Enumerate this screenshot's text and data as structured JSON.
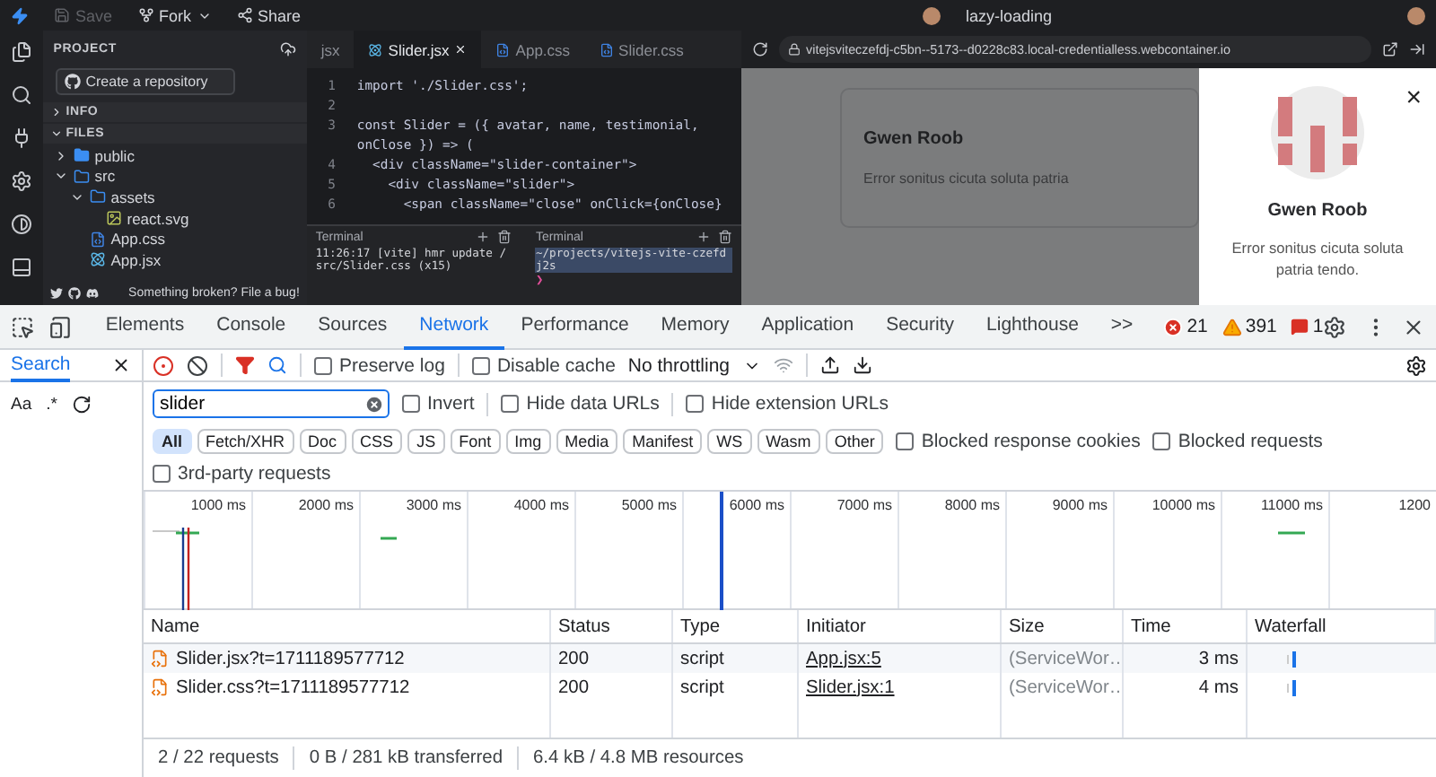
{
  "topbar": {
    "save": {
      "label": "Save",
      "disabled": true
    },
    "fork": "Fork",
    "share": "Share",
    "project": "lazy-loading"
  },
  "sidebar": {
    "title": "PROJECT",
    "repo_button": "Create a repository",
    "sections": [
      {
        "label": "INFO",
        "expanded": false
      },
      {
        "label": "FILES",
        "expanded": true
      }
    ],
    "tree": [
      {
        "name": "public",
        "kind": "folder",
        "expanded": false
      },
      {
        "name": "src",
        "kind": "folder",
        "expanded": true,
        "children": [
          {
            "name": "assets",
            "kind": "folder",
            "expanded": true,
            "children": [
              {
                "name": "react.svg",
                "kind": "image"
              }
            ]
          },
          {
            "name": "App.css",
            "kind": "css"
          },
          {
            "name": "App.jsx",
            "kind": "jsx"
          }
        ]
      }
    ],
    "footer": "Something broken? File a bug!"
  },
  "editor": {
    "tabs": [
      {
        "label": "jsx",
        "selected": false
      },
      {
        "label": "Slider.jsx",
        "selected": true
      },
      {
        "label": "App.css",
        "selected": false
      },
      {
        "label": "Slider.css",
        "selected": false
      }
    ],
    "lines": [
      {
        "number": "1",
        "text": "import './Slider.css';"
      },
      {
        "number": "2"
      },
      {
        "number": "3",
        "text": "const Slider = ({ avatar, name, testimonial,"
      },
      {
        "text": "onClose }) => ("
      },
      {
        "number": "4",
        "text": "  <div className=\"slider-container\">"
      },
      {
        "number": "5",
        "text": "    <div className=\"slider\">"
      },
      {
        "number": "6",
        "text": "      <span className=\"close\" onClick={onClose}"
      }
    ],
    "terminals": [
      {
        "title": "Terminal",
        "output": "11:26:17 [vite] hmr update /src/Slider.css (x15)"
      },
      {
        "title": "Terminal",
        "output": "~/projects/vitejs-vite-czefdj2s",
        "prompt": "❯"
      }
    ]
  },
  "preview": {
    "url": "vitejsviteczefdj-c5bn--5173--d0228c83.local-credentialless.webcontainer.io",
    "card": {
      "name": "Gwen Roob",
      "text": "Error sonitus cicuta soluta patria"
    },
    "modal": {
      "name": "Gwen Roob",
      "text": "Error sonitus cicuta soluta patria tendo.",
      "close": "×"
    }
  },
  "devtools": {
    "tabs": [
      {
        "label": "Elements",
        "selected": false
      },
      {
        "label": "Console",
        "selected": false
      },
      {
        "label": "Sources",
        "selected": false
      },
      {
        "label": "Network",
        "selected": true
      },
      {
        "label": "Performance",
        "selected": false
      },
      {
        "label": "Memory",
        "selected": false
      },
      {
        "label": "Application",
        "selected": false
      },
      {
        "label": "Security",
        "selected": false
      },
      {
        "label": "Lighthouse",
        "selected": false
      }
    ],
    "more": ">>",
    "errors": "21",
    "warnings": "391",
    "issues": "1",
    "search_pane": {
      "tab": "Search",
      "match_case": "Aa",
      "regex": ".*"
    },
    "toolbar": {
      "preserve_log": {
        "label": "Preserve log",
        "checked": false
      },
      "disable_cache": {
        "label": "Disable cache",
        "checked": false
      },
      "throttling": "No throttling"
    },
    "filter": {
      "value": "slider",
      "options": [
        {
          "label": "Invert",
          "checked": false
        },
        {
          "label": "Hide data URLs",
          "checked": false
        },
        {
          "label": "Hide extension URLs",
          "checked": false
        }
      ]
    },
    "types": [
      {
        "label": "All",
        "selected": true
      },
      {
        "label": "Fetch/XHR",
        "selected": false
      },
      {
        "label": "Doc",
        "selected": false
      },
      {
        "label": "CSS",
        "selected": false
      },
      {
        "label": "JS",
        "selected": false
      },
      {
        "label": "Font",
        "selected": false
      },
      {
        "label": "Img",
        "selected": false
      },
      {
        "label": "Media",
        "selected": false
      },
      {
        "label": "Manifest",
        "selected": false
      },
      {
        "label": "WS",
        "selected": false
      },
      {
        "label": "Wasm",
        "selected": false
      },
      {
        "label": "Other",
        "selected": false
      }
    ],
    "type_options": [
      {
        "label": "Blocked response cookies",
        "checked": false
      },
      {
        "label": "Blocked requests",
        "checked": false
      }
    ],
    "third_party": {
      "label": "3rd-party requests",
      "checked": false
    },
    "overview_ticks": [
      "1000 ms",
      "2000 ms",
      "3000 ms",
      "4000 ms",
      "5000 ms",
      "6000 ms",
      "7000 ms",
      "8000 ms",
      "9000 ms",
      "10000 ms",
      "11000 ms",
      "1200"
    ],
    "table": {
      "columns": [
        "Name",
        "Status",
        "Type",
        "Initiator",
        "Size",
        "Time",
        "Waterfall"
      ],
      "rows": [
        {
          "name": "Slider.jsx?t=1711189577712",
          "status": "200",
          "type": "script",
          "initiator": "App.jsx:5",
          "size": "(ServiceWor…",
          "time": "3 ms"
        },
        {
          "name": "Slider.css?t=1711189577712",
          "status": "200",
          "type": "script",
          "initiator": "Slider.jsx:1",
          "size": "(ServiceWor…",
          "time": "4 ms"
        }
      ]
    },
    "status_bar": [
      "2 / 22 requests",
      "0 B / 281 kB transferred",
      "6.4 kB / 4.8 MB resources"
    ]
  }
}
